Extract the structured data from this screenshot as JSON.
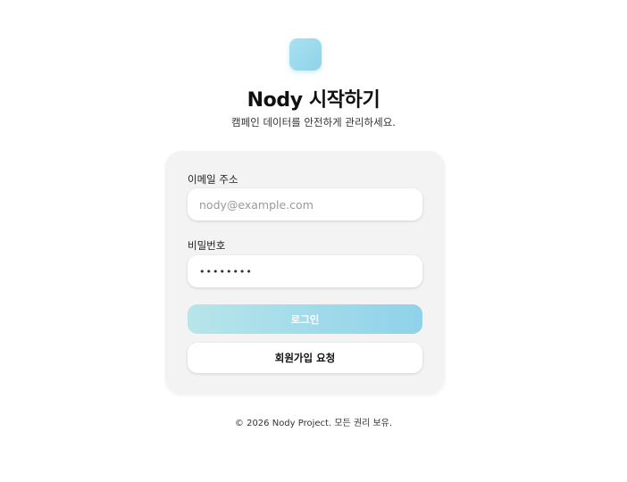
{
  "header": {
    "title": "Nody 시작하기",
    "subtitle": "캠페인 데이터를 안전하게 관리하세요."
  },
  "form": {
    "email_label": "이메일 주소",
    "email_placeholder": "nody@example.com",
    "email_value": "",
    "password_label": "비밀번호",
    "password_value": "••••••••",
    "login_label": "로그인",
    "signup_label": "회원가입 요청"
  },
  "footer": {
    "text": "© 2026 Nody Project. 모든 권리 보유."
  },
  "colors": {
    "accent_start": "#b7e5ea",
    "accent_end": "#8fd2ea",
    "card_bg": "#f3f3f3"
  },
  "icons": {
    "logo": "app-logo-icon"
  }
}
